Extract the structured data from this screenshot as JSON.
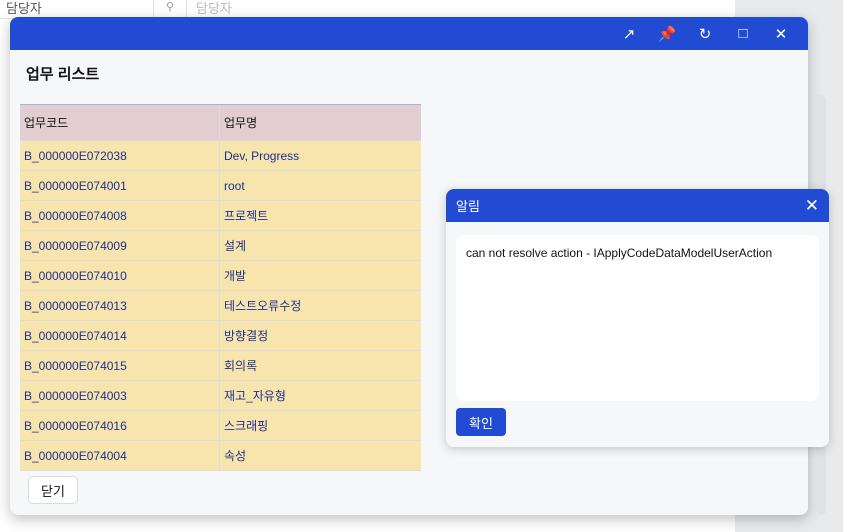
{
  "background": {
    "label": "담당자",
    "search_placeholder": "담당자"
  },
  "dialog": {
    "title": "업무 리스트",
    "columns": [
      "업무코드",
      "업무명"
    ],
    "rows": [
      [
        "B_000000E072038",
        "Dev, Progress"
      ],
      [
        "B_000000E074001",
        "root"
      ],
      [
        "B_000000E074008",
        "프로젝트"
      ],
      [
        "B_000000E074009",
        "설계"
      ],
      [
        "B_000000E074010",
        "개발"
      ],
      [
        "B_000000E074013",
        "테스트오류수정"
      ],
      [
        "B_000000E074014",
        "방향결정"
      ],
      [
        "B_000000E074015",
        "회의록"
      ],
      [
        "B_000000E074003",
        "재고_자유형"
      ],
      [
        "B_000000E074016",
        "스크래핑"
      ],
      [
        "B_000000E074004",
        "속성"
      ]
    ],
    "close_label": "닫기"
  },
  "alert": {
    "title": "알림",
    "message": "can not resolve action - IApplyCodeDataModelUserAction",
    "ok_label": "확인"
  }
}
